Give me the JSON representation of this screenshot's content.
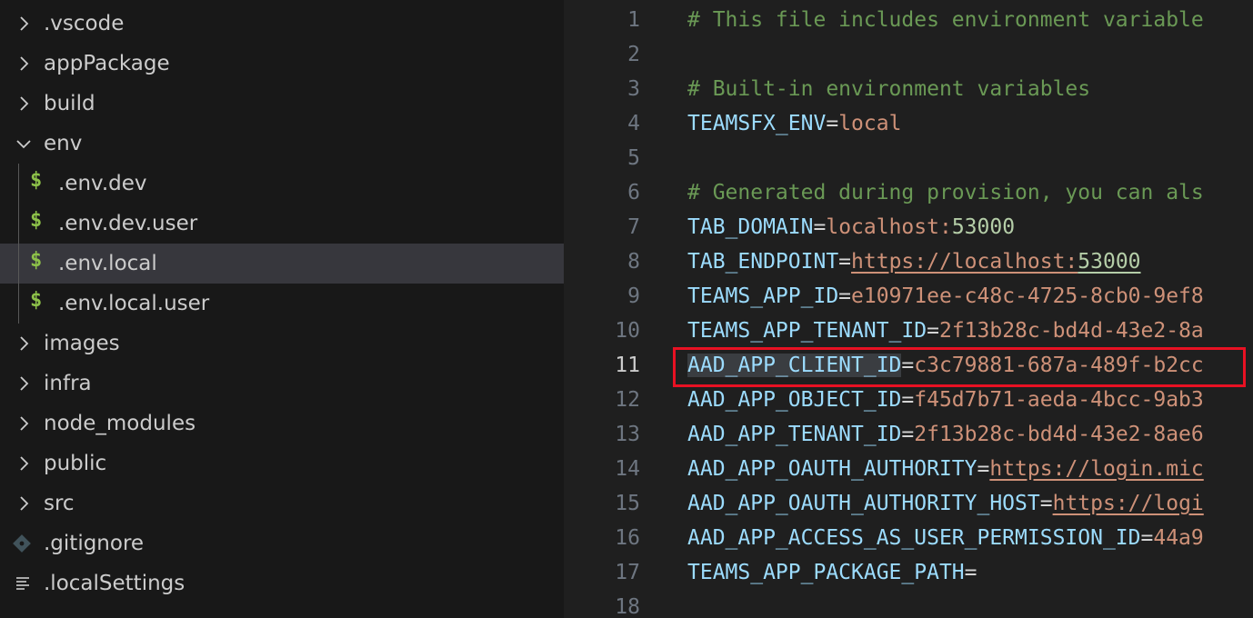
{
  "explorer": {
    "items": [
      {
        "label": ".vscode",
        "type": "folder",
        "state": "collapsed",
        "icon": "chevron-right-icon"
      },
      {
        "label": "appPackage",
        "type": "folder",
        "state": "collapsed",
        "icon": "chevron-right-icon"
      },
      {
        "label": "build",
        "type": "folder",
        "state": "collapsed",
        "icon": "chevron-right-icon"
      },
      {
        "label": "env",
        "type": "folder",
        "state": "expanded",
        "icon": "chevron-down-icon"
      },
      {
        "label": ".env.dev",
        "type": "file",
        "icon": "dollar-icon",
        "icon_glyph": "$"
      },
      {
        "label": ".env.dev.user",
        "type": "file",
        "icon": "dollar-icon",
        "icon_glyph": "$"
      },
      {
        "label": ".env.local",
        "type": "file",
        "icon": "dollar-icon",
        "icon_glyph": "$",
        "selected": true
      },
      {
        "label": ".env.local.user",
        "type": "file",
        "icon": "dollar-icon",
        "icon_glyph": "$"
      },
      {
        "label": "images",
        "type": "folder",
        "state": "collapsed",
        "icon": "chevron-right-icon"
      },
      {
        "label": "infra",
        "type": "folder",
        "state": "collapsed",
        "icon": "chevron-right-icon"
      },
      {
        "label": "node_modules",
        "type": "folder",
        "state": "collapsed",
        "icon": "chevron-right-icon"
      },
      {
        "label": "public",
        "type": "folder",
        "state": "collapsed",
        "icon": "chevron-right-icon"
      },
      {
        "label": "src",
        "type": "folder",
        "state": "collapsed",
        "icon": "chevron-right-icon"
      },
      {
        "label": ".gitignore",
        "type": "file",
        "icon": "git-icon"
      },
      {
        "label": ".localSettings",
        "type": "file",
        "icon": "lines-icon"
      }
    ]
  },
  "editor": {
    "active_line": 11,
    "lines": [
      {
        "n": "1",
        "comment": "# This file includes environment variable"
      },
      {
        "n": "2"
      },
      {
        "n": "3",
        "comment": "# Built-in environment variables"
      },
      {
        "n": "4",
        "key": "TEAMSFX_ENV",
        "eq": "=",
        "val": "local"
      },
      {
        "n": "5"
      },
      {
        "n": "6",
        "comment": "# Generated during provision, you can als"
      },
      {
        "n": "7",
        "key": "TAB_DOMAIN",
        "eq": "=",
        "val": "localhost:",
        "num": "53000"
      },
      {
        "n": "8",
        "key": "TAB_ENDPOINT",
        "eq": "=",
        "url": "https://localhost:",
        "url_num": "53000"
      },
      {
        "n": "9",
        "key": "TEAMS_APP_ID",
        "eq": "=",
        "val": "e10971ee-c48c-4725-8cb0-9ef8"
      },
      {
        "n": "10",
        "key": "TEAMS_APP_TENANT_ID",
        "eq": "=",
        "val": "2f13b28c-bd4d-43e2-8a"
      },
      {
        "n": "11",
        "key": "AAD_APP_CLIENT_ID",
        "eq": "=",
        "val": "c3c79881-687a-489f-b2cc",
        "key_selected": true
      },
      {
        "n": "12",
        "key": "AAD_APP_OBJECT_ID",
        "eq": "=",
        "val": "f45d7b71-aeda-4bcc-9ab3"
      },
      {
        "n": "13",
        "key": "AAD_APP_TENANT_ID",
        "eq": "=",
        "val": "2f13b28c-bd4d-43e2-8ae6"
      },
      {
        "n": "14",
        "key": "AAD_APP_OAUTH_AUTHORITY",
        "eq": "=",
        "url": "https://login.mic"
      },
      {
        "n": "15",
        "key": "AAD_APP_OAUTH_AUTHORITY_HOST",
        "eq": "=",
        "url": "https://logi"
      },
      {
        "n": "16",
        "key": "AAD_APP_ACCESS_AS_USER_PERMISSION_ID",
        "eq": "=",
        "val": "44a9"
      },
      {
        "n": "17",
        "key": "TEAMS_APP_PACKAGE_PATH",
        "eq": "="
      },
      {
        "n": "18"
      }
    ]
  },
  "colors": {
    "sidebar_bg": "#181818",
    "editor_bg": "#1f1f1f",
    "selected_row": "#37373d",
    "comment": "#6a9955",
    "key": "#9cdcfe",
    "value": "#ce9178",
    "number": "#b5cea8",
    "env_icon": "#8dc149",
    "highlight_box": "#e81123"
  }
}
